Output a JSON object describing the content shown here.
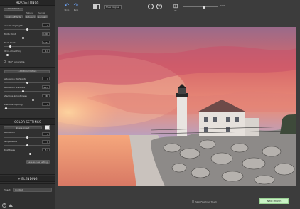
{
  "sidebar": {
    "hdr_title": "HDR SETTINGS",
    "select_preset": "Select Preset",
    "lighting": "Lighting Effects",
    "preset_labels": [
      "Natural",
      "Surreal"
    ],
    "preset_dropdowns": [
      "Natural ▾",
      "Surreal ▾"
    ],
    "sliders": [
      {
        "label": "Smooth Highlights",
        "value": "0"
      },
      {
        "label": "White Point",
        "value": "0.000"
      },
      {
        "label": "Black Point",
        "value": "0.074"
      },
      {
        "label": "Micro-smoothing",
        "value": "0.0"
      }
    ],
    "checkbox_360": "360° panorama",
    "advanced": "+ Additional Options",
    "adv_sliders": [
      {
        "label": "Saturation Highlights",
        "value": "0"
      },
      {
        "label": "Saturation Shadows",
        "value": "-10.0"
      },
      {
        "label": "Shadows Smoothness",
        "value": "60"
      },
      {
        "label": "Shadows Clipping",
        "value": "0"
      }
    ],
    "color_title": "COLOR SETTINGS",
    "color_preset": "Image preset",
    "color_sliders": [
      {
        "label": "Saturation",
        "value": "0"
      },
      {
        "label": "Temperature",
        "value": "0"
      },
      {
        "label": "Brightness",
        "value": "7.4"
      }
    ],
    "save_btn": "Save as new settings",
    "blending_title": "+ BLENDING",
    "preset_label": "Preset:",
    "preset_value": "Untitled"
  },
  "toolbar": {
    "undo": "Undo",
    "redo": "Redo",
    "show_original": "Show Original",
    "fit": "Fit",
    "zoom_pct": "100%"
  },
  "bottom": {
    "skip_label": "Skip Finishing Touch",
    "next": "Next: Finish",
    "help": "?"
  },
  "colors": {
    "accent": "#6ea8ff",
    "next_bg": "#c9f2c5"
  }
}
